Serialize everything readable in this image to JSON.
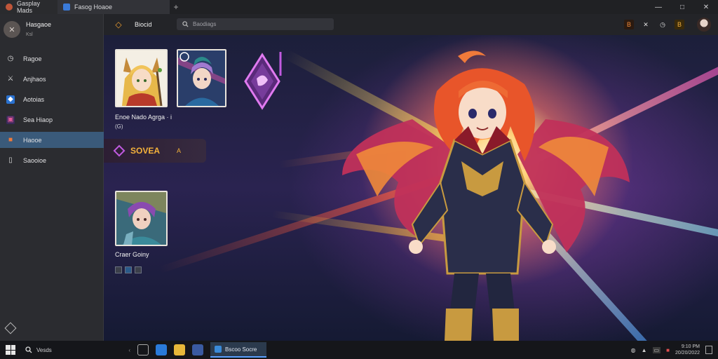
{
  "titlebar": {
    "tabs": [
      {
        "label": "Gasplay Mads"
      },
      {
        "label": "Fasog Hoaoe"
      }
    ],
    "new_tab_icon": "plus-icon",
    "controls": {
      "minimize": "—",
      "maximize": "□",
      "close": "✕"
    }
  },
  "sidebar": {
    "profile": {
      "name": "Hasgaoe",
      "sub": "Ksl",
      "avatar_glyph": "✕"
    },
    "items": [
      {
        "label": "Ragoe",
        "icon": "clock-icon",
        "glyph": "◷"
      },
      {
        "label": "Anjhaos",
        "icon": "sword-icon",
        "glyph": "⚔"
      },
      {
        "label": "Aotoias",
        "icon": "tag-icon",
        "glyph": "◆"
      },
      {
        "label": "Sea Hiaop",
        "icon": "image-icon",
        "glyph": "▣"
      },
      {
        "label": "Haooe",
        "icon": "square-icon",
        "glyph": "■",
        "active": true
      },
      {
        "label": "Saooioe",
        "icon": "book-icon",
        "glyph": "▯"
      }
    ]
  },
  "toolbar": {
    "back_glyph": "◇",
    "title": "Biocid",
    "search_placeholder": "Baodiags",
    "buttons": [
      "B",
      "✕",
      "◷",
      "B"
    ]
  },
  "content": {
    "card1": {
      "title": "Enoe Nado Agrga · i",
      "sub": "(G)"
    },
    "banner": {
      "text": "SOVEA",
      "caret": "A"
    },
    "card2": {
      "title": "Craer Goiny"
    }
  },
  "taskbar": {
    "search_label": "Vesds",
    "active_app_label": "Bscoo Socre",
    "clock_time": "9:10 PM",
    "clock_date": "20/20/2022"
  },
  "colors": {
    "accent": "#3a5a7a",
    "banner_text": "#f5b23a",
    "toolbar_accent": "#f0a030"
  }
}
